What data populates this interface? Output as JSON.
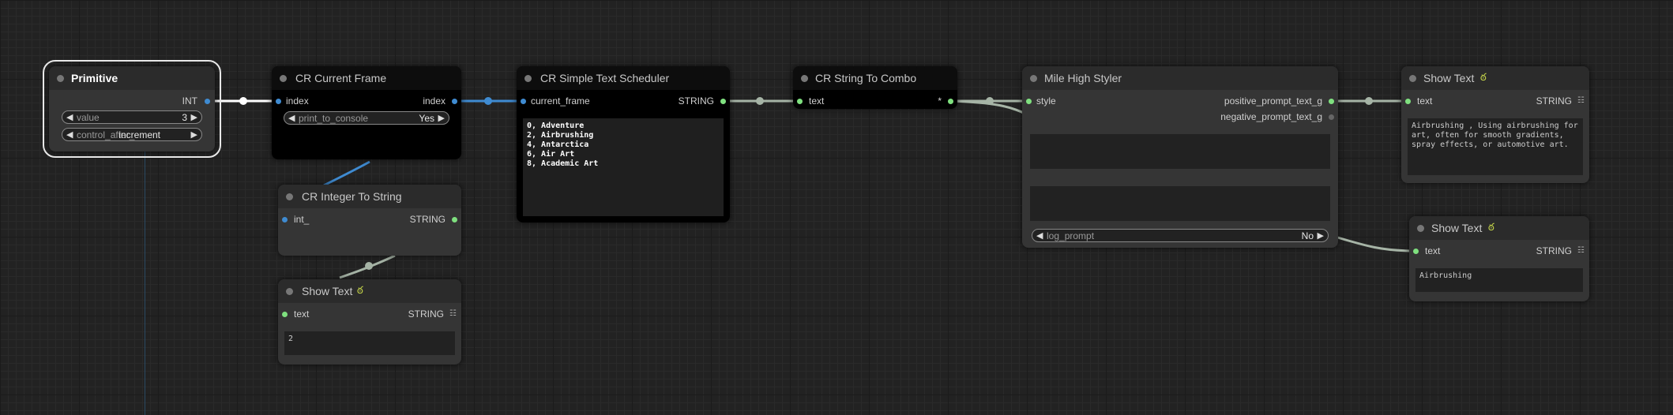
{
  "nodes": {
    "primitive": {
      "title": "Primitive",
      "out_label": "INT",
      "value_label": "value",
      "value": "3",
      "control_label": "control_after_",
      "control_value": "increment"
    },
    "current_frame": {
      "title": "CR Current Frame",
      "in_label": "index",
      "out_label": "index",
      "widget_label": "print_to_console",
      "widget_value": "Yes"
    },
    "int_to_string": {
      "title": "CR Integer To String",
      "in_label": "int_",
      "out_label": "STRING"
    },
    "show_text_1": {
      "title": "Show Text",
      "in_label": "text",
      "out_label": "STRING",
      "content": "2"
    },
    "scheduler": {
      "title": "CR Simple Text Scheduler",
      "in_label": "current_frame",
      "out_label": "STRING",
      "schedule": "0, Adventure\n2, Airbrushing\n4, Antarctica\n6, Air Art\n8, Academic Art"
    },
    "string_to_combo": {
      "title": "CR String To Combo",
      "in_label": "text",
      "out_label": "*"
    },
    "styler": {
      "title": "Mile High Styler",
      "in_label": "style",
      "out1_label": "positive_prompt_text_g",
      "out2_label": "negative_prompt_text_g",
      "widget_label": "log_prompt",
      "widget_value": "No"
    },
    "show_text_2": {
      "title": "Show Text",
      "in_label": "text",
      "out_label": "STRING",
      "content": "Airbrushing , Using airbrushing for art, often for smooth gradients, spray effects, or automotive art."
    },
    "show_text_3": {
      "title": "Show Text",
      "in_label": "text",
      "out_label": "STRING",
      "content": "Airbrushing"
    }
  },
  "icons": {
    "python": "python-icon",
    "grid": "grid-icon"
  },
  "colors": {
    "int_wire": "#ffffff",
    "index_wire": "#3f8bd1",
    "string_wire": "#a6b4a6",
    "string_slot": "#7fe07f"
  }
}
